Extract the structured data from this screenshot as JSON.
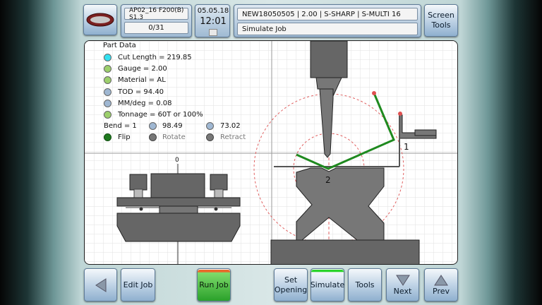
{
  "header": {
    "logo_text": "MURATEC",
    "program": "AP02_16 F200(B) S1.3",
    "counter": "0/31",
    "date": "05.05.18",
    "time": "12:01",
    "job_info": "NEW18050505 | 2.00 | S-SHARP | S-MULTI 16",
    "mode": "Simulate Job",
    "screen_tools_label": "Screen\nTools"
  },
  "part_data": {
    "title": "Part Data",
    "items": [
      {
        "text": "Cut Length = 219.85",
        "color": "#33e0f0"
      },
      {
        "text": "Gauge = 2.00",
        "color": "#9ccf6c"
      },
      {
        "text": "Material = AL",
        "color": "#9ccf6c"
      },
      {
        "text": "TOD = 94.40",
        "color": "#9fb7d2"
      },
      {
        "text": "MM/deg = 0.08",
        "color": "#9fb7d2"
      },
      {
        "text": "Tonnage = 60T or 100%",
        "color": "#9ccf6c"
      }
    ],
    "bend": "Bend = 1",
    "value_a": "98.49",
    "value_b": "73.02",
    "flip": "Flip",
    "rotate": "Rotate",
    "retract": "Retract"
  },
  "tooling_view": {
    "zero_label": "0"
  },
  "simulation": {
    "bend_label_1": "1",
    "bend_label_2": "2",
    "part_color": "#1f8a1f",
    "marker_color": "#e05050"
  },
  "toolbar": {
    "edit_job": "Edit Job",
    "run_job": "Run Job",
    "set_opening": "Set\nOpening",
    "simulate": "Simulate",
    "tools": "Tools",
    "next": "Next",
    "prev": "Prev"
  }
}
